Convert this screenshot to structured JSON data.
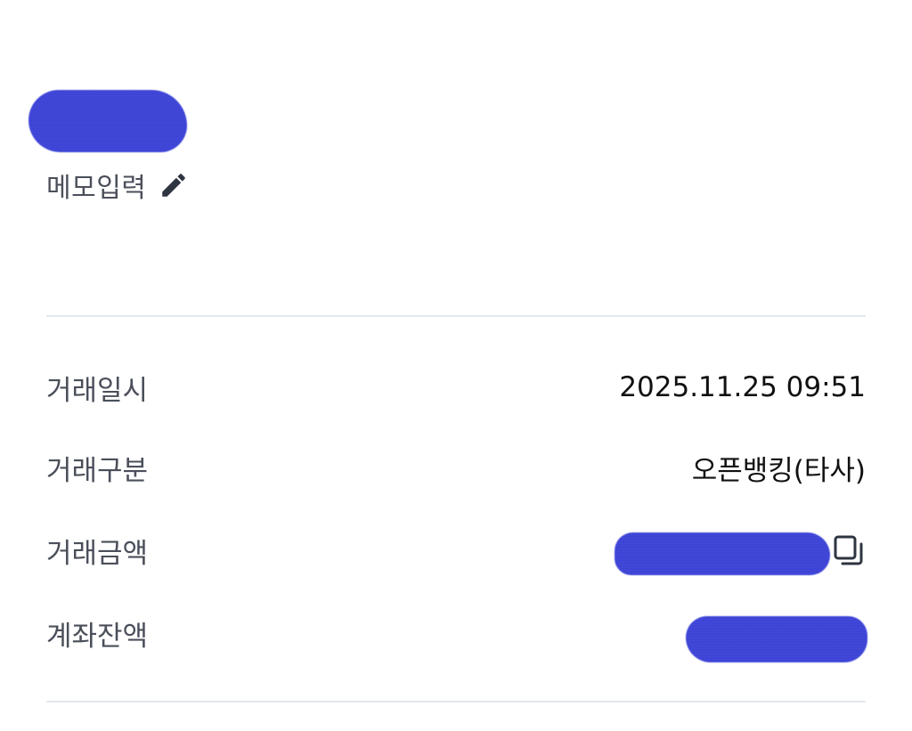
{
  "header": {
    "memo_label": "메모입력",
    "memo_icon": "pencil-icon"
  },
  "details": [
    {
      "label": "거래일시",
      "value": "2025.11.25 09:51"
    },
    {
      "label": "거래구분",
      "value": "오픈뱅킹(타사)"
    },
    {
      "label": "거래금액",
      "value": "",
      "copy_icon": "copy-icon"
    },
    {
      "label": "계좌잔액",
      "value": ""
    }
  ],
  "colors": {
    "redaction": "#3b42d6",
    "label_text": "#4a4f5a",
    "value_text": "#111111",
    "divider": "#e3e7ee"
  }
}
